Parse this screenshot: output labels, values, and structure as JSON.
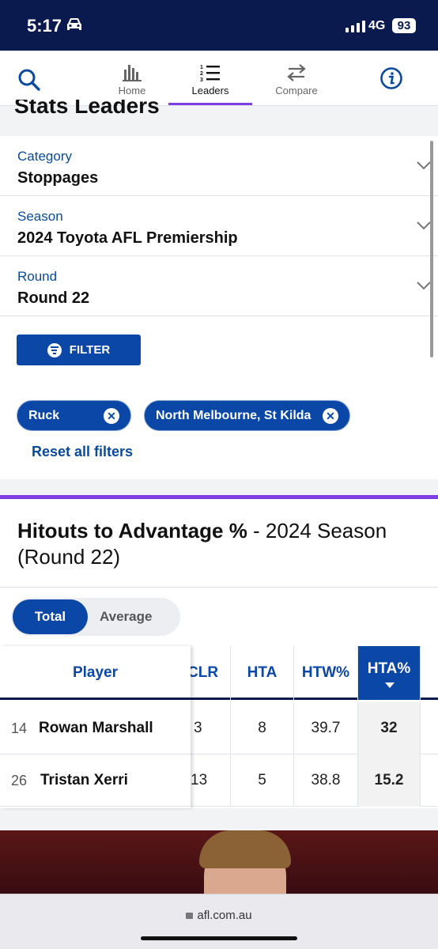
{
  "status_bar": {
    "time": "5:17",
    "network": "4G",
    "battery": "93"
  },
  "nav": {
    "tabs": [
      {
        "label": "Home",
        "icon": "bar-chart-icon"
      },
      {
        "label": "Leaders",
        "icon": "numbered-list-icon",
        "active": true
      },
      {
        "label": "Compare",
        "icon": "swap-arrows-icon"
      }
    ]
  },
  "page": {
    "title": "Stats Leaders"
  },
  "filters": {
    "category": {
      "label": "Category",
      "value": "Stoppages"
    },
    "season": {
      "label": "Season",
      "value": "2024 Toyota AFL Premiership"
    },
    "round": {
      "label": "Round",
      "value": "Round 22"
    },
    "filter_button": "FILTER",
    "chips": [
      "Ruck",
      "North Melbourne, St Kilda"
    ],
    "reset": "Reset all filters"
  },
  "section": {
    "title_bold": "Hitouts to Advantage %",
    "title_rest": " - 2024 Season (Round 22)",
    "toggle": {
      "active": "Total",
      "inactive": "Average"
    }
  },
  "table": {
    "player_header": "Player",
    "columns": [
      "CLR",
      "HTA",
      "HTW%",
      "HTA%"
    ],
    "sorted_column": "HTA%",
    "rows": [
      {
        "rank": "14",
        "name": "Rowan Marshall",
        "clr": "3",
        "hta": "8",
        "htw": "39.7",
        "hta_pct": "32"
      },
      {
        "rank": "26",
        "name": "Tristan Xerri",
        "clr": "13",
        "hta": "5",
        "htw": "38.8",
        "hta_pct": "15.2"
      }
    ]
  },
  "browser": {
    "url": "afl.com.au"
  },
  "colors": {
    "navy": "#0b1a4e",
    "brand_blue": "#0b47a6",
    "accent_purple": "#7b3fe4",
    "label_blue": "#0a4a9c"
  }
}
